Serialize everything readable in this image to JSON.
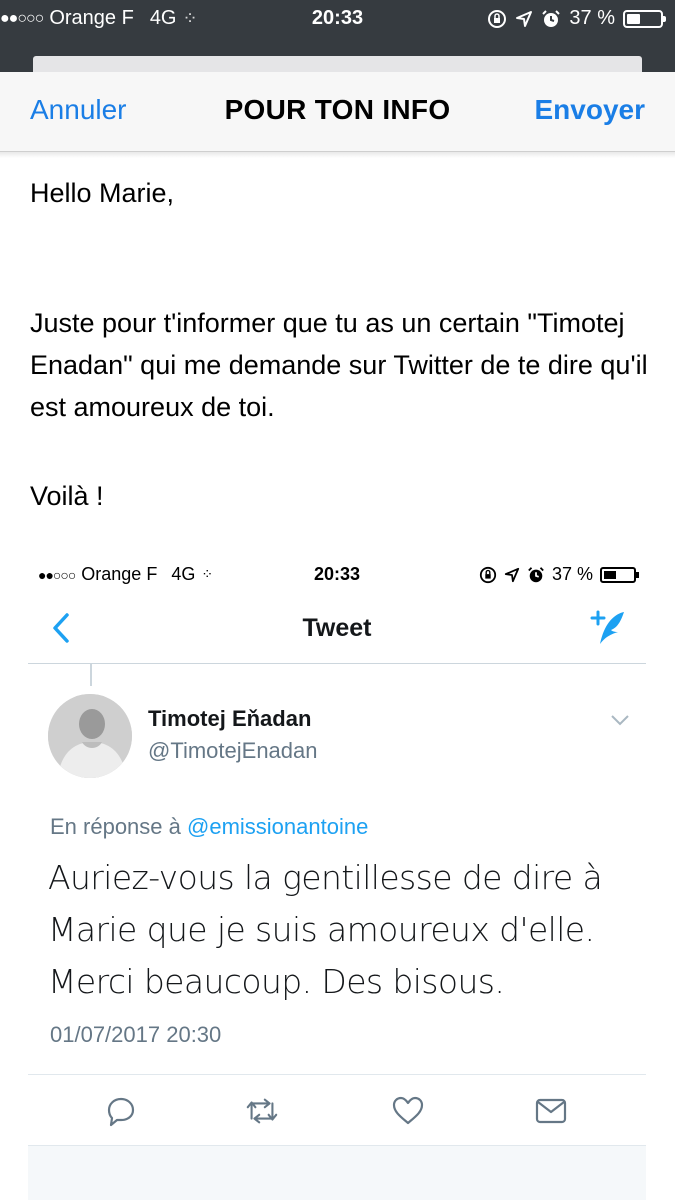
{
  "status_bar": {
    "signal": "●●○○○",
    "carrier": "Orange F",
    "network": "4G",
    "time": "20:33",
    "battery_text": "37 %",
    "battery_level": 0.37
  },
  "mail_header": {
    "cancel_label": "Annuler",
    "title": "POUR TON INFO",
    "send_label": "Envoyer"
  },
  "mail_body": {
    "greeting": "Hello Marie,",
    "message": "Juste pour t'informer que tu as un certain \"Timotej Enadan\" qui me demande sur Twitter de te dire qu'il est amoureux de toi.",
    "closing": "Voilà !"
  },
  "embedded": {
    "status_bar": {
      "signal": "●●○○○",
      "carrier": "Orange F",
      "network": "4G",
      "time": "20:33",
      "battery_text": "37 %",
      "battery_level": 0.37
    },
    "nav": {
      "title": "Tweet",
      "back_icon": "chevron-left-icon",
      "compose_icon": "compose-tweet-icon"
    },
    "tweet": {
      "author": "Timotej Eňadan",
      "handle": "@TimotejEnadan",
      "reply_prefix": "En réponse à",
      "reply_mention": "@emissionantoine",
      "text": "Auriez-vous la gentillesse de dire à Marie que je suis amoureux d'elle. Merci beaucoup. Des bisous.",
      "timestamp": "01/07/2017 20:30"
    },
    "actions": [
      "reply-icon",
      "retweet-icon",
      "like-icon",
      "direct-message-icon"
    ],
    "colors": {
      "accent": "#1da1f2",
      "muted": "#657786",
      "text": "#14171a"
    }
  },
  "colors": {
    "ios_blue": "#1a7ee6",
    "status_bar_bg": "#363b40"
  }
}
